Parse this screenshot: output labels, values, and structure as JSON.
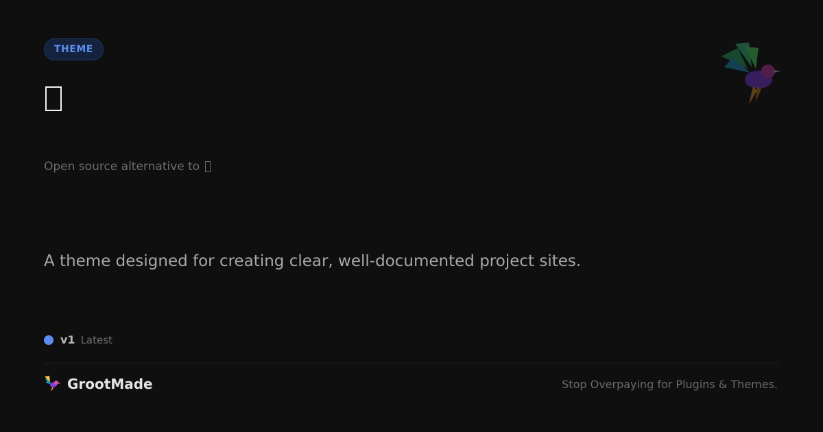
{
  "badge": {
    "label": "THEME"
  },
  "subtitle": {
    "text": "Open source alternative  to"
  },
  "description": "A theme designed for creating clear, well-documented  project sites.",
  "version": {
    "number": "v1",
    "tag": "Latest"
  },
  "brand": {
    "name": "GrootMade",
    "logo_icon": "hummingbird-icon"
  },
  "tagline": "Stop Overpaying  for Plugins & Themes.",
  "colors": {
    "background": "#0f0f0f",
    "accent": "#5b8ef0",
    "badge_bg": "#14223d"
  }
}
